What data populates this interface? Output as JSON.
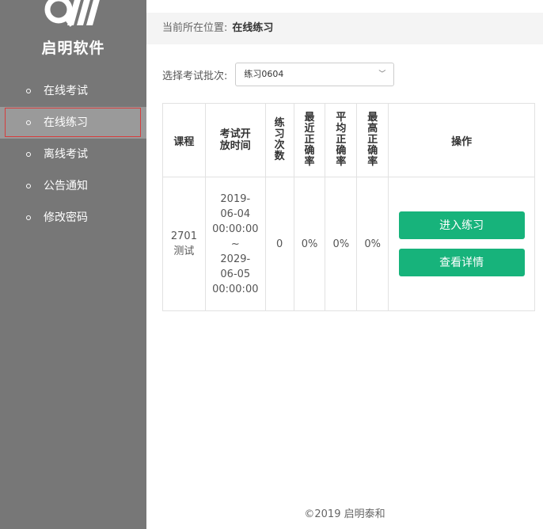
{
  "brand": {
    "name": "启明软件"
  },
  "sidebar": {
    "items": [
      {
        "label": "在线考试"
      },
      {
        "label": "在线练习"
      },
      {
        "label": "离线考试"
      },
      {
        "label": "公告通知"
      },
      {
        "label": "修改密码"
      }
    ],
    "active_index": 1
  },
  "breadcrumb": {
    "prefix": "当前所在位置:",
    "current": "在线练习"
  },
  "filter": {
    "label": "选择考试批次:",
    "selected": "练习0604"
  },
  "table": {
    "headers": [
      "课程",
      "考试开放时间",
      "练习次数",
      "最近正确率",
      "平均正确率",
      "最高正确率",
      "操作"
    ],
    "rows": [
      {
        "course": "2701测试",
        "time": [
          "2019-",
          "06-04",
          "00:00:00",
          "~",
          "2029-",
          "06-05",
          "00:00:00"
        ],
        "count": "0",
        "recent": "0%",
        "avg": "0%",
        "max": "0%",
        "actions": [
          "进入练习",
          "查看详情"
        ]
      }
    ]
  },
  "footer": {
    "text": "©2019 启明泰和"
  },
  "colors": {
    "sidebar": "#777777",
    "accent": "#17b37b",
    "active_outline": "#d63d3d"
  }
}
